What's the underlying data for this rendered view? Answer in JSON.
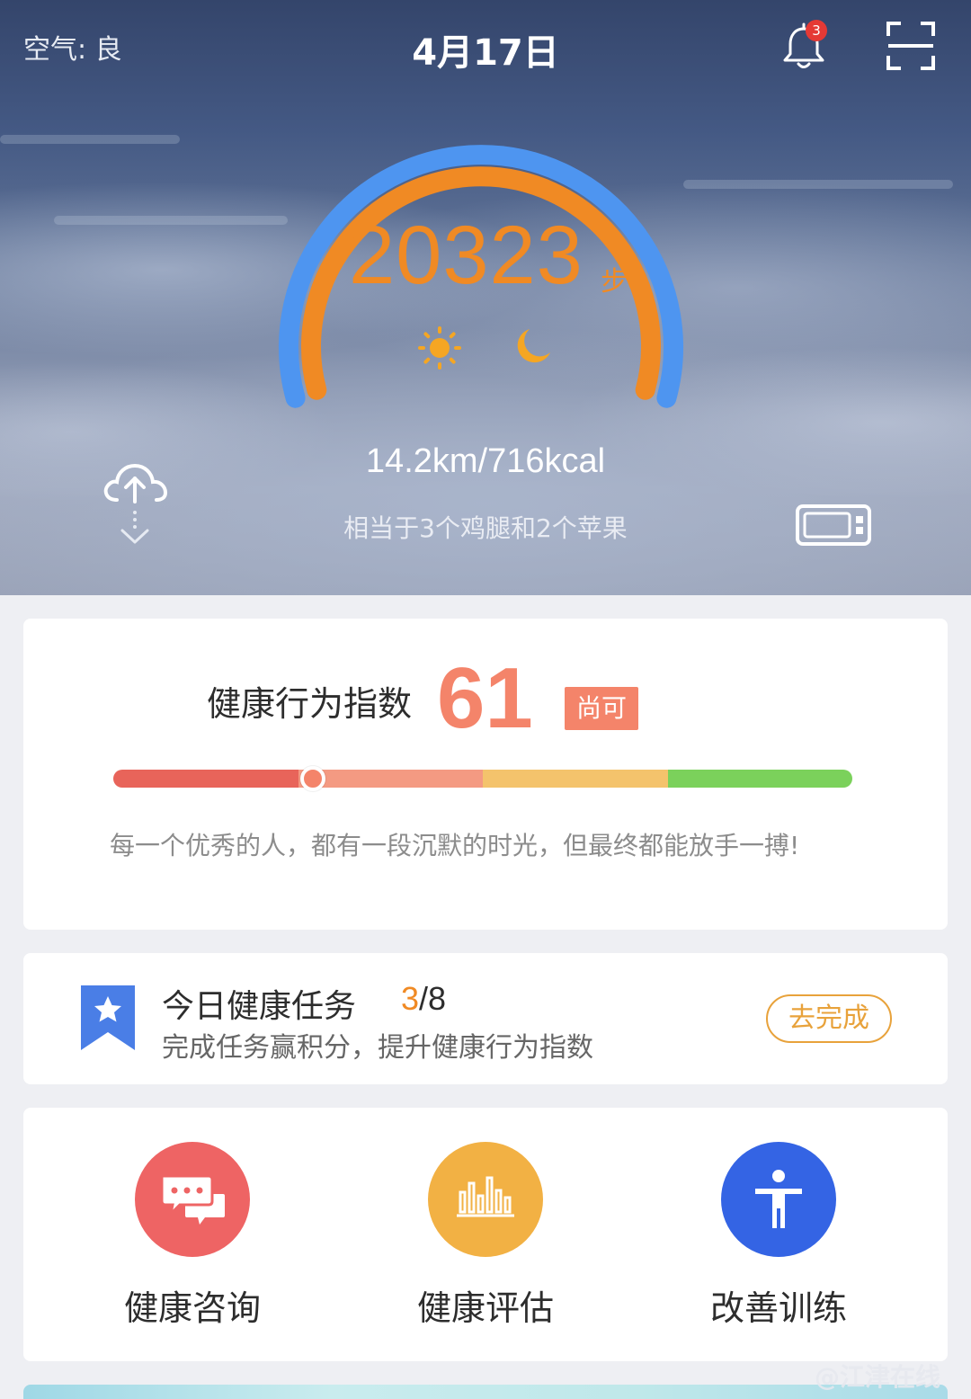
{
  "header": {
    "air_quality": "空气: 良",
    "date": "4月17日",
    "notification_count": "3"
  },
  "activity": {
    "steps": "20323",
    "steps_unit": "步",
    "distance_calories": "14.2km/716kcal",
    "equivalent": "相当于3个鸡腿和2个苹果"
  },
  "health_index": {
    "title": "健康行为指数",
    "score": "61",
    "level": "尚可",
    "score_fraction": 0.27,
    "quote": "每一个优秀的人，都有一段沉默的时光，但最终都能放手一搏!",
    "segments": [
      {
        "color": "#e8645a"
      },
      {
        "color": "#f49a82"
      },
      {
        "color": "#f4c36c"
      },
      {
        "color": "#7bd15b"
      }
    ]
  },
  "task": {
    "title": "今日健康任务",
    "done": "3",
    "total": "/8",
    "subtitle": "完成任务赢积分，提升健康行为指数",
    "button": "去完成"
  },
  "services": [
    {
      "label": "健康咨询",
      "icon": "chat-bubbles-icon",
      "color": "#ee6464"
    },
    {
      "label": "健康评估",
      "icon": "bar-chart-icon",
      "color": "#f2b144"
    },
    {
      "label": "改善训练",
      "icon": "person-icon",
      "color": "#3464e4"
    }
  ],
  "watermark": "@江津在线",
  "colors": {
    "orange": "#f08a24",
    "blue_ring": "#4e95f0",
    "index_accent": "#f4846a"
  }
}
